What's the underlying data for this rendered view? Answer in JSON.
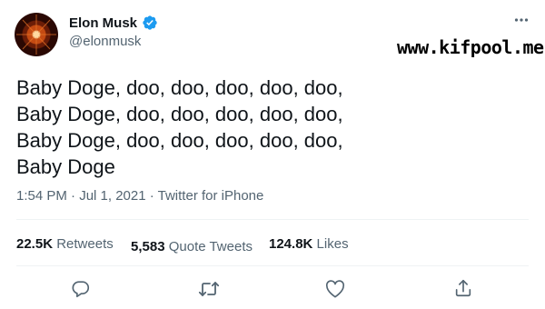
{
  "author": {
    "display_name": "Elon Musk",
    "handle": "@elonmusk",
    "verified": true,
    "verified_color": "#1d9bf0"
  },
  "watermark": "www.kifpool.me",
  "tweet": {
    "lines": [
      "Baby Doge, doo, doo, doo, doo, doo,",
      "Baby Doge, doo, doo, doo, doo, doo,",
      "Baby Doge, doo, doo, doo, doo, doo,",
      "Baby Doge"
    ]
  },
  "meta": "1:54 PM · Jul 1, 2021 · Twitter for iPhone",
  "stats": {
    "retweets_count": "22.5K",
    "retweets_label": "Retweets",
    "quotes_count": "5,583",
    "quotes_label": "Quote Tweets",
    "likes_count": "124.8K",
    "likes_label": "Likes"
  },
  "icons": {
    "more": "more-icon",
    "reply": "reply-icon",
    "retweet": "retweet-icon",
    "like": "like-icon",
    "share": "share-icon"
  },
  "colors": {
    "text": "#0f1419",
    "secondary": "#536471",
    "divider": "#eff3f4"
  }
}
